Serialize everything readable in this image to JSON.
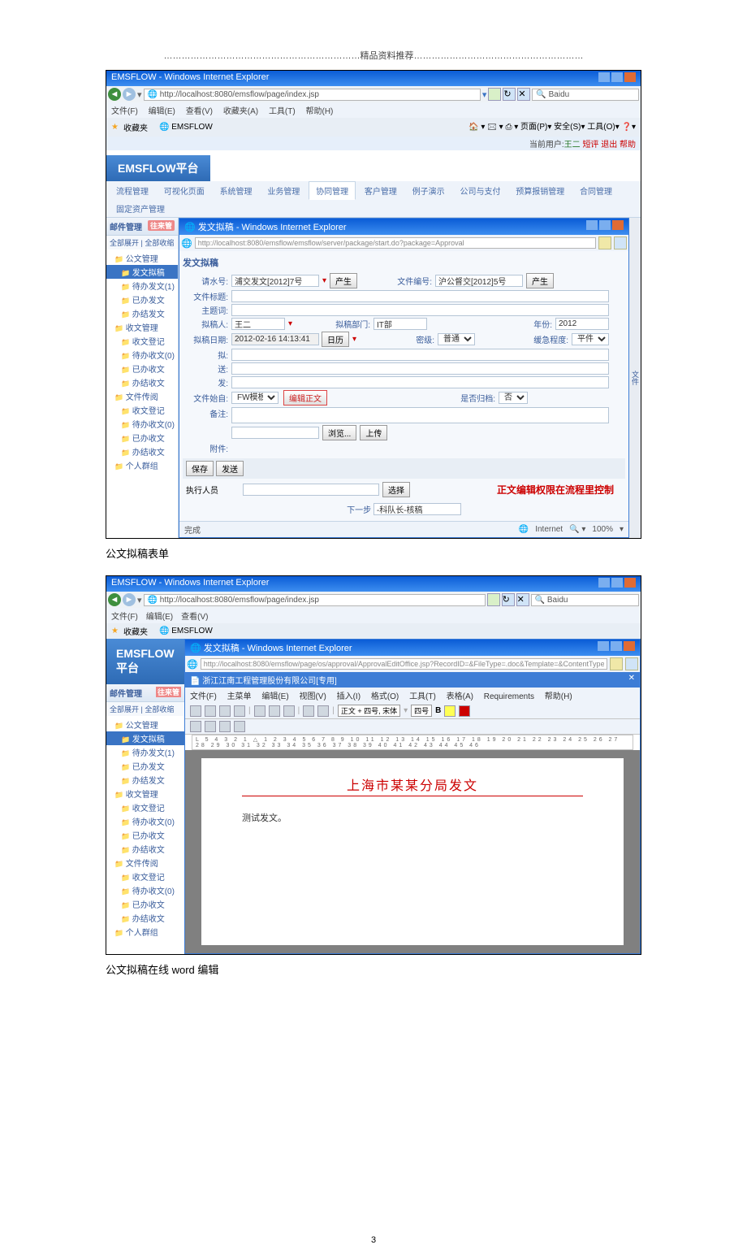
{
  "header": "…………………………………………………………精品资料推荐…………………………………………………",
  "shot1": {
    "ie_title": "EMSFLOW - Windows Internet Explorer",
    "url": "http://localhost:8080/emsflow/page/index.jsp",
    "search_engine": "Baidu",
    "menu": {
      "file": "文件(F)",
      "edit": "编辑(E)",
      "view": "查看(V)",
      "fav": "收藏夹(A)",
      "tool": "工具(T)",
      "help": "帮助(H)"
    },
    "fav_label": "收藏夹",
    "tab_label": "EMSFLOW",
    "ie_tools": "🏠 ▾  🖂 ▾  ⎙ ▾  页面(P)▾  安全(S)▾  工具(O)▾  ❓▾",
    "topright": {
      "pre": "当前用户:",
      "user": "王二",
      "verify": "短评",
      "exit": "退出",
      "help": "帮助"
    },
    "logo": "EMSFLOW平台",
    "nav": [
      "流程管理",
      "可视化页面",
      "系统管理",
      "业务管理",
      "协同管理",
      "客户管理",
      "例子演示",
      "公司与支付",
      "预算报销管理",
      "合同管理",
      "固定资产管理"
    ],
    "nav_sel": 4,
    "side": {
      "hdr": "邮件管理",
      "btn": "往来管",
      "ops": "全部展开 | 全部收缩",
      "tree": [
        {
          "t": "公文管理",
          "c": "fold"
        },
        {
          "t": "发文拟稿",
          "c": "fold sel l1"
        },
        {
          "t": "待办发文(1)",
          "c": "fold l1"
        },
        {
          "t": "已办发文",
          "c": "fold l1"
        },
        {
          "t": "办结发文",
          "c": "fold l1"
        },
        {
          "t": "收文管理",
          "c": "fold"
        },
        {
          "t": "收文登记",
          "c": "fold l1"
        },
        {
          "t": "待办收文(0)",
          "c": "fold l1"
        },
        {
          "t": "已办收文",
          "c": "fold l1"
        },
        {
          "t": "办结收文",
          "c": "fold l1"
        },
        {
          "t": "文件传阅",
          "c": "fold"
        },
        {
          "t": "收文登记",
          "c": "fold l1"
        },
        {
          "t": "待办收文(0)",
          "c": "fold l1"
        },
        {
          "t": "已办收文",
          "c": "fold l1"
        },
        {
          "t": "办结收文",
          "c": "fold l1"
        },
        {
          "t": "个人群组",
          "c": "fold"
        }
      ]
    },
    "popup": {
      "title": "发文拟稿 - Windows Internet Explorer",
      "url": "http://localhost:8080/emsflow/emsflow/server/package/start.do?package=Approval",
      "form_title": "发文拟稿",
      "f": {
        "lbl_flow": "请水号:",
        "flow": "浦交发文[2012]7号",
        "btn_gen": "产生",
        "lbl_docno": "文件编号:",
        "docno": "沪公督交[2012]5号",
        "btn_gen2": "产生",
        "lbl_filetitle": "文件标题:",
        "lbl_subject": "主题词:",
        "lbl_person": "拟稿人:",
        "person": "王二",
        "lbl_dept": "拟稿部门:",
        "dept": "IT部",
        "lbl_year": "年份:",
        "year": "2012",
        "lbl_date": "拟稿日期:",
        "date": "2012-02-16 14:13:41",
        "btn_cal": "日历",
        "cal_marker": "▾",
        "lbl_sec": "密级:",
        "sec": "普通",
        "sec_opts": [
          "普通"
        ],
        "lbl_urg": "缓急程度:",
        "urg": "平件",
        "urg_opts": [
          "平件"
        ],
        "lbl_to": "拟:",
        "lbl_cc": "送:",
        "lbl_from": "发:",
        "lbl_tmpl": "文件始自:",
        "tmpl": "FW模板",
        "tmpl_opts": [
          "FW模板"
        ],
        "btn_edit": "编辑正文",
        "lbl_arch": "是否归档:",
        "arch": "否",
        "arch_opts": [
          "否"
        ],
        "lbl_note": "备注:",
        "btn_browse": "浏览...",
        "btn_upload": "上传",
        "lbl_attach": "附件:",
        "btn_save": "保存",
        "btn_send": "发送",
        "lbl_exec": "执行人员",
        "btn_select": "选择",
        "note_red": "正文编辑权限在流程里控制",
        "next": "下一步",
        "next_val": "-科队长-核稿"
      }
    },
    "status": {
      "done": "完成",
      "net": "Internet",
      "zoom": "100%",
      "zoomctl": "🔍 ▾"
    },
    "sidefile": "文件"
  },
  "caption1": "公文拟稿表单",
  "shot2": {
    "ie_title": "EMSFLOW - Windows Internet Explorer",
    "url": "http://localhost:8080/emsflow/page/index.jsp",
    "popup_title": "发文拟稿 - Windows Internet Explorer",
    "popup_url": "http://localhost:8080/emsflow/page/os/approval/ApprovalEditOffice.jsp?RecordID=&FileType=.doc&Template=&ContentType=&EditType=1,1",
    "word_title": "浙江江南工程管理股份有限公司[专用]",
    "word_menu": {
      "file": "文件(F)",
      "main": "主菜单",
      "edit": "编辑(E)",
      "view": "视图(V)",
      "ins": "插入(I)",
      "fmt": "格式(O)",
      "tool": "工具(T)",
      "tbl": "表格(A)",
      "req": "Requirements",
      "help": "帮助(H)"
    },
    "style": "正文 + 四号, 宋体",
    "font": "四号",
    "bold": "B",
    "ruler": "L  5  4  3  2  1  △  1  2  3  4  5  6  7  8  9  10  11  12  13  14  15  16  17  18  19  20  21  22  23  24  25  26  27  28  29  30  31  32  33  34  35  36  37  38  39  40  41  42  43  44  45  46",
    "red_title": "上海市某某分局发文",
    "body": "测试发文。"
  },
  "caption2": "公文拟稿在线 word 编辑",
  "page_num": "3"
}
